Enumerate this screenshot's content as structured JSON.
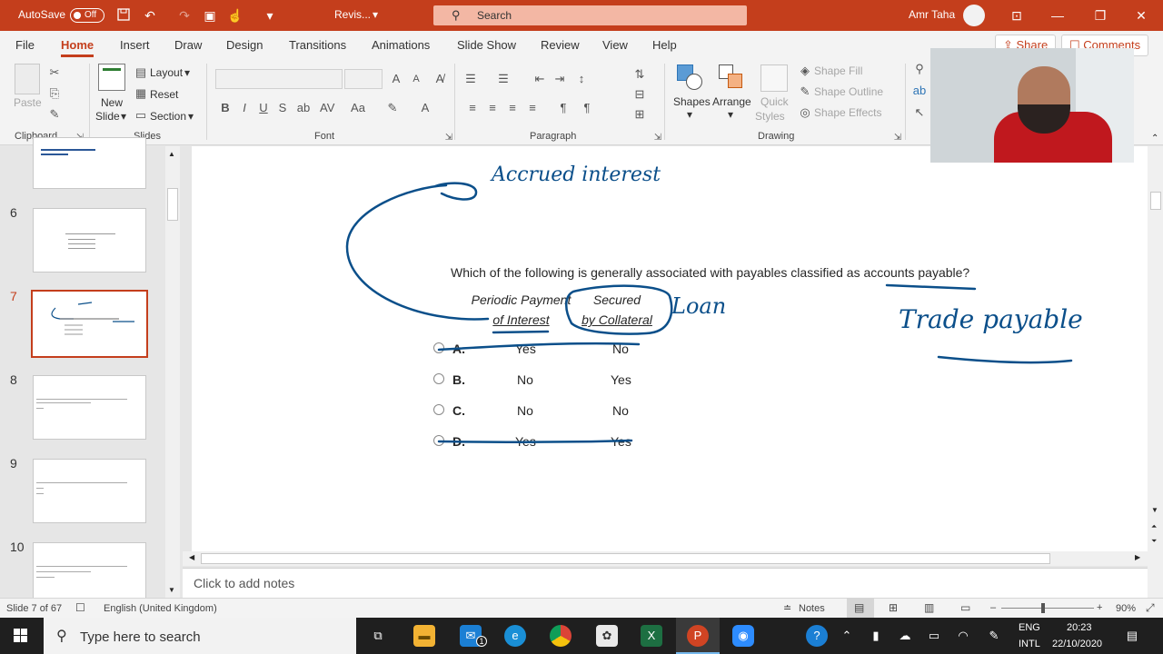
{
  "titlebar": {
    "autosave_label": "AutoSave",
    "autosave_state": "Off",
    "doc_title": "Revis...",
    "search_placeholder": "Search",
    "user_name": "Amr Taha"
  },
  "tabs": [
    "File",
    "Home",
    "Insert",
    "Draw",
    "Design",
    "Transitions",
    "Animations",
    "Slide Show",
    "Review",
    "View",
    "Help"
  ],
  "active_tab": "Home",
  "share": {
    "share_label": "Share",
    "comments_label": "Comments"
  },
  "ribbon": {
    "clipboard": {
      "paste": "Paste",
      "group": "Clipboard"
    },
    "slides": {
      "new_slide_1": "New",
      "new_slide_2": "Slide",
      "layout": "Layout",
      "reset": "Reset",
      "section": "Section",
      "group": "Slides"
    },
    "font": {
      "group": "Font",
      "bold": "B",
      "italic": "I",
      "underline": "U",
      "strike": "S"
    },
    "paragraph": {
      "group": "Paragraph"
    },
    "drawing": {
      "shapes": "Shapes",
      "arrange": "Arrange",
      "quick_styles_1": "Quick",
      "quick_styles_2": "Styles",
      "shape_fill": "Shape Fill",
      "shape_outline": "Shape Outline",
      "shape_effects": "Shape Effects",
      "group": "Drawing"
    }
  },
  "thumbnails": [
    {
      "num": "6"
    },
    {
      "num": "7",
      "selected": true
    },
    {
      "num": "8"
    },
    {
      "num": "9"
    },
    {
      "num": "10"
    }
  ],
  "slide": {
    "question": "Which of the following is generally associated with payables classified as accounts payable?",
    "col1_line1": "Periodic Payment",
    "col1_line2": "of Interest",
    "col2_line1": "Secured",
    "col2_line2": "by Collateral",
    "options": [
      {
        "letter": "A.",
        "c1": "Yes",
        "c2": "No"
      },
      {
        "letter": "B.",
        "c1": "No",
        "c2": "Yes"
      },
      {
        "letter": "C.",
        "c1": "No",
        "c2": "No"
      },
      {
        "letter": "D.",
        "c1": "Yes",
        "c2": "Yes"
      }
    ],
    "ink_accrued": "Accrued interest",
    "ink_loan": "Loan",
    "ink_trade": "Trade payable"
  },
  "notes_placeholder": "Click to add notes",
  "status": {
    "slide_count": "Slide 7 of 67",
    "language": "English (United Kingdom)",
    "notes": "Notes",
    "zoom": "90%"
  },
  "taskbar": {
    "search_placeholder": "Type here to search",
    "lang_1": "ENG",
    "lang_2": "INTL",
    "time": "20:23",
    "date": "22/10/2020",
    "mail_badge": "1"
  },
  "colors": {
    "accent": "#c43e1c",
    "ink": "#0b4f8a"
  }
}
